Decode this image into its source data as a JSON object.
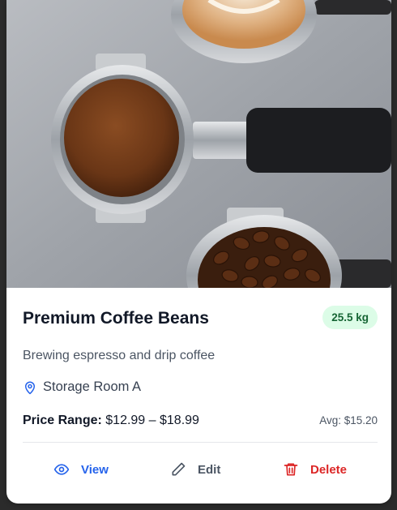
{
  "card": {
    "title": "Premium Coffee Beans",
    "quantity_badge": "25.5 kg",
    "description": "Brewing espresso and drip coffee",
    "location": "Storage Room A",
    "price_label": "Price Range:",
    "price_value": "$12.99 – $18.99",
    "avg_price": "Avg: $15.20"
  },
  "actions": {
    "view_label": "View",
    "edit_label": "Edit",
    "delete_label": "Delete"
  },
  "colors": {
    "badge_bg": "#dcfce7",
    "badge_text": "#166534",
    "view": "#2563eb",
    "edit": "#4b5563",
    "delete": "#dc2626"
  },
  "icons": [
    "location-pin-icon",
    "eye-icon",
    "pencil-icon",
    "trash-icon"
  ]
}
